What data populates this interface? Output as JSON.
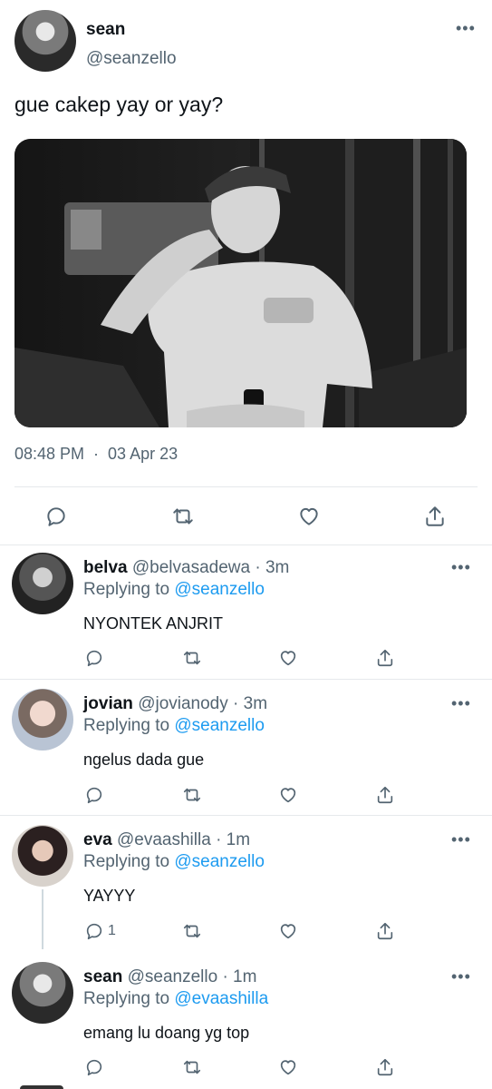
{
  "main_tweet": {
    "name": "sean",
    "handle": "@seanzello",
    "text": "gue cakep yay or yay?",
    "time": "08:48 PM",
    "separator": "·",
    "date": "03 Apr 23"
  },
  "icons": {
    "more": "more-dots-icon",
    "reply": "reply-bubble-icon",
    "retweet": "retweet-icon",
    "like": "heart-icon",
    "share": "share-icon"
  },
  "replies": [
    {
      "name": "belva",
      "handle": "@belvasadewa",
      "meta": "· 3m",
      "replying_prefix": "Replying to",
      "replying_to": "@seanzello",
      "text": "NYONTEK ANJRIT",
      "reply_count": ""
    },
    {
      "name": "jovian",
      "handle": "@jovianody",
      "meta": "· 3m",
      "replying_prefix": "Replying to",
      "replying_to": "@seanzello",
      "text": "ngelus dada gue",
      "reply_count": ""
    },
    {
      "name": "eva",
      "handle": "@evaashilla",
      "meta": "· 1m",
      "replying_prefix": "Replying to",
      "replying_to": "@seanzello",
      "text": "YAYYY",
      "reply_count": "1"
    },
    {
      "name": "sean",
      "handle": "@seanzello",
      "meta": "· 1m",
      "replying_prefix": "Replying to",
      "replying_to": "@evaashilla",
      "text": "emang lu doang yg top",
      "reply_count": ""
    }
  ]
}
